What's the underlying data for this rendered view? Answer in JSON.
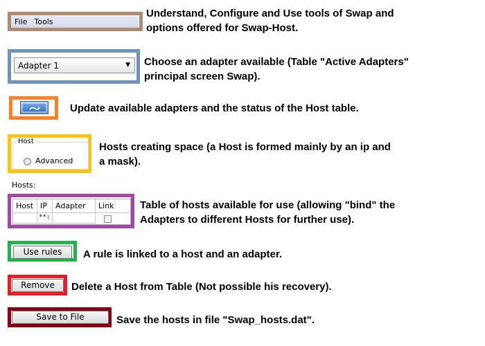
{
  "menu": {
    "file": "File",
    "tools": "Tools"
  },
  "adapter_select": {
    "value": "Adapter 1"
  },
  "hosts_group": {
    "legend": "Host",
    "advanced_label": "Advanced"
  },
  "hosts_table": {
    "title": "Hosts:",
    "columns": [
      "Host",
      "IP",
      "Adapter",
      "Link"
    ],
    "row": {
      "ip": "**:"
    }
  },
  "buttons": {
    "use_rules": "Use rules",
    "remove": "Remove",
    "save_to_file": "Save to File"
  },
  "descriptions": {
    "menu_1": "Understand, Configure and Use tools of Swap and",
    "menu_2": "options offered for Swap-Host.",
    "adapter_1": "Choose an adapter available (Table \"Active Adapters\"",
    "adapter_2": "principal screen Swap).",
    "refresh": "Update available adapters and the status of the Host  table.",
    "hosts_1": "Hosts creating space (a Host is formed mainly by an ip and",
    "hosts_2": "a mask).",
    "table_1": "Table of hosts available for use (allowing \"bind\" the",
    "table_2": "Adapters to different Hosts for further use).",
    "rules": "A rule is linked to a host and an adapter.",
    "remove": "Delete a Host from Table (Not possible his recovery).",
    "save": "Save the hosts in file \"Swap_hosts.dat\"."
  },
  "colors": {
    "menu_frame": "#b08b72",
    "adapter_frame": "#7092be",
    "refresh_frame": "#ff7f27",
    "hosts_frame": "#ffc20e",
    "table_frame": "#a349a4",
    "rules_frame": "#22b14c",
    "remove_frame": "#ed1c24",
    "save_frame": "#880015"
  },
  "icons": {
    "combo_arrow": "chevron-down-icon",
    "refresh": "refresh-icon"
  }
}
